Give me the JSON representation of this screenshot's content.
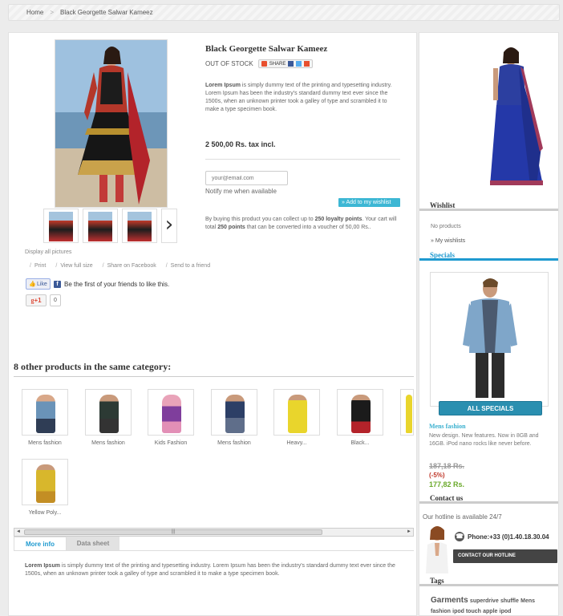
{
  "breadcrumb": {
    "home": "Home",
    "sep": ">",
    "current": "Black Georgette Salwar Kameez"
  },
  "product": {
    "title": "Black Georgette Salwar Kameez",
    "stock": "OUT OF STOCK",
    "share_label": "SHARE",
    "desc_bold": "Lorem Ipsum",
    "desc_rest": " is simply dummy text of the printing and typesetting industry. Lorem Ipsum has been the industry's standard dummy text ever since the 1500s, when an unknown printer took a galley of type and scrambled it to make a type specimen book.",
    "price": "2 500,00 Rs. tax incl.",
    "email_placeholder": "your@email.com",
    "notify": "Notify me when available",
    "wishlist_btn": "» Add to my wishlist",
    "loyalty_a": "By buying this product you can collect up to ",
    "loyalty_b": "250 loyalty points",
    "loyalty_c": ". Your cart will total ",
    "loyalty_d": "250 points",
    "loyalty_e": " that can be converted into a voucher of 50,00 Rs.."
  },
  "gallery": {
    "display_all": "Display all pictures",
    "next_arrow": "›"
  },
  "actions": [
    {
      "label": "Print"
    },
    {
      "label": "View full size"
    },
    {
      "label": "Share on Facebook"
    },
    {
      "label": "Send to a friend"
    }
  ],
  "social": {
    "like": "Like",
    "like_text": "Be the first of your friends to like this.",
    "gplus": "+1",
    "gcount": "0"
  },
  "other": {
    "title": "8 other products in the same category:",
    "items": [
      {
        "label": "Mens fashion"
      },
      {
        "label": "Mens fashion"
      },
      {
        "label": "Kids Fashion"
      },
      {
        "label": "Mens fashion"
      },
      {
        "label": "Heavy..."
      },
      {
        "label": "Black..."
      },
      {
        "label": "Yellow Poly..."
      }
    ]
  },
  "scrollbar": {
    "left": "◄",
    "right": "►",
    "grip": "|||"
  },
  "tabs": {
    "more_info": "More info",
    "data_sheet": "Data sheet"
  },
  "more_info": {
    "bold": "Lorem Ipsum",
    "rest": " is simply dummy text of the printing and typesetting industry. Lorem Ipsum has been the industry's standard dummy text ever since the 1500s, when an unknown printer took a galley of type and scrambled it to make a type specimen book."
  },
  "sidebar": {
    "wishlist_title": "Wishlist",
    "no_products": "No products",
    "my_wishlists": "» My wishlists",
    "specials_title": "Specials",
    "all_specials": "ALL SPECIALS",
    "special_name": "Mens fashion",
    "special_desc": "New design. New features. Now in 8GB and 16GB. iPod nano rocks like never before.",
    "old_price": "187,18 Rs.",
    "discount": "(-5%)",
    "new_price": "177,82 Rs.",
    "contact_title": "Contact us",
    "hotline": "Our hotline is available 24/7",
    "phone": "Phone:+33 (0)1.40.18.30.04",
    "contact_btn": "CONTACT OUR HOTLINE",
    "tags_title": "Tags",
    "tags": [
      "Garments",
      "superdrive",
      "shuffle",
      "Mens",
      "fashion",
      "ipod touch",
      "apple",
      "ipod"
    ]
  },
  "colors": {
    "accent": "#1f9ad0",
    "wishlist_btn": "#3db7d4",
    "all_specials": "#2a8fb0",
    "discount": "#c0392b",
    "new_price": "#6aa92a"
  }
}
